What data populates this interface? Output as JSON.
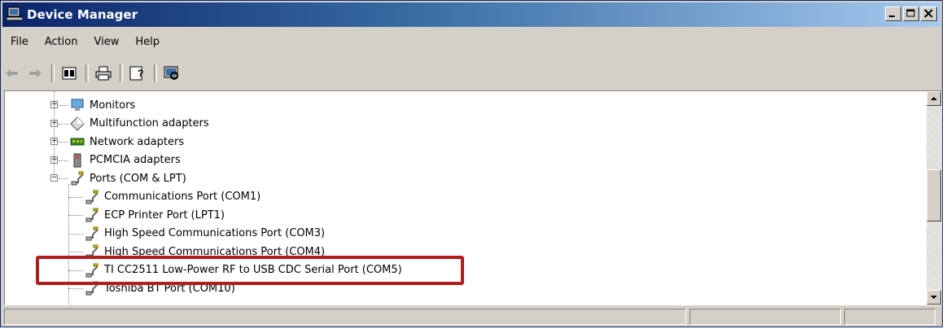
{
  "window": {
    "title": "Device Manager"
  },
  "menubar": {
    "items": [
      {
        "label": "File"
      },
      {
        "label": "Action"
      },
      {
        "label": "View"
      },
      {
        "label": "Help"
      }
    ]
  },
  "toolbar": {
    "icons": [
      "back-icon",
      "forward-icon",
      "properties-icon",
      "print-icon",
      "help-icon",
      "scan-hardware-icon"
    ]
  },
  "tree": {
    "items": [
      {
        "label": "Monitors",
        "icon": "monitor-icon",
        "expander": "+"
      },
      {
        "label": "Multifunction adapters",
        "icon": "multifunction-icon",
        "expander": "+"
      },
      {
        "label": "Network adapters",
        "icon": "network-icon",
        "expander": "+"
      },
      {
        "label": "PCMCIA adapters",
        "icon": "pcmcia-icon",
        "expander": "+"
      },
      {
        "label": "Ports (COM & LPT)",
        "icon": "port-icon",
        "expander": "−"
      },
      {
        "label": "Communications Port (COM1)",
        "icon": "port-icon"
      },
      {
        "label": "ECP Printer Port (LPT1)",
        "icon": "port-icon"
      },
      {
        "label": "High Speed Communications Port (COM3)",
        "icon": "port-icon"
      },
      {
        "label": "High Speed Communications Port (COM4)",
        "icon": "port-icon"
      },
      {
        "label": "TI CC2511 Low-Power RF to USB CDC Serial Port (COM5)",
        "icon": "port-icon"
      },
      {
        "label": "Toshiba BT Port (COM10)",
        "icon": "port-icon"
      }
    ]
  },
  "colors": {
    "highlight": "#b21d1d",
    "title_gradient_start": "#0a246a"
  }
}
